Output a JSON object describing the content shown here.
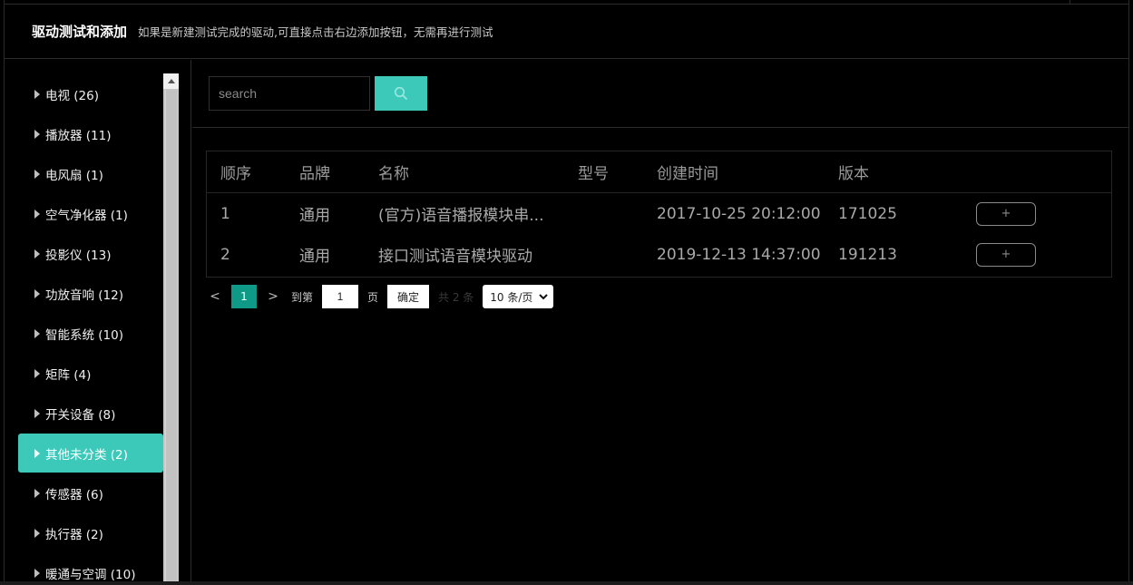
{
  "header": {
    "title": "驱动测试和添加",
    "subtitle": "如果是新建测试完成的驱动,可直接点击右边添加按钮，无需再进行测试"
  },
  "sidebar": {
    "items": [
      {
        "label": "电视 (26)",
        "active": false
      },
      {
        "label": "播放器 (11)",
        "active": false
      },
      {
        "label": "电风扇 (1)",
        "active": false
      },
      {
        "label": "空气净化器 (1)",
        "active": false
      },
      {
        "label": "投影仪 (13)",
        "active": false
      },
      {
        "label": "功放音响 (12)",
        "active": false
      },
      {
        "label": "智能系统 (10)",
        "active": false
      },
      {
        "label": "矩阵 (4)",
        "active": false
      },
      {
        "label": "开关设备 (8)",
        "active": false
      },
      {
        "label": "其他未分类 (2)",
        "active": true
      },
      {
        "label": "传感器 (6)",
        "active": false
      },
      {
        "label": "执行器 (2)",
        "active": false
      },
      {
        "label": "暖通与空调 (10)",
        "active": false
      }
    ]
  },
  "search": {
    "placeholder": "search",
    "value": ""
  },
  "table": {
    "headers": [
      "顺序",
      "品牌",
      "名称",
      "型号",
      "创建时间",
      "版本",
      ""
    ],
    "rows": [
      {
        "index": "1",
        "brand": "通用",
        "name": "(官方)语音播报模块串...",
        "model": "",
        "created": "2017-10-25 20:12:00",
        "version": "171025",
        "action": "+"
      },
      {
        "index": "2",
        "brand": "通用",
        "name": "接口测试语音模块驱动",
        "model": "",
        "created": "2019-12-13 14:37:00",
        "version": "191213",
        "action": "+"
      }
    ]
  },
  "pager": {
    "prev": "<",
    "current": "1",
    "next": ">",
    "goto_label": "到第",
    "goto_value": "1",
    "page_label": "页",
    "confirm": "确定",
    "total": "共 2 条",
    "page_size": "10 条/页"
  },
  "colors": {
    "accent": "#3cc9b9",
    "pager_active": "#0f9a88",
    "background": "#000000"
  }
}
